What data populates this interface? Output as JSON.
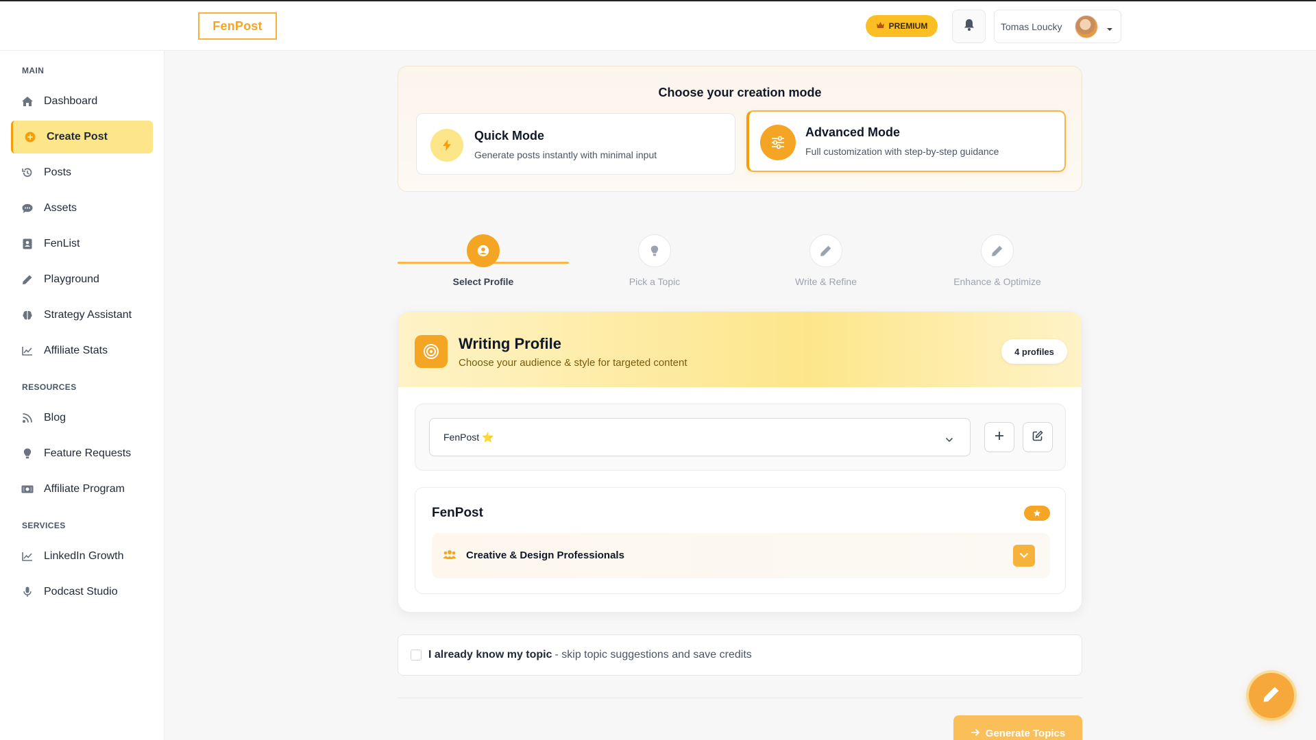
{
  "header": {
    "logo": "FenPost",
    "premium_label": "PREMIUM",
    "user_name": "Tomas Loucky"
  },
  "sidebar": {
    "sections": [
      {
        "title": "MAIN",
        "items": [
          {
            "label": "Dashboard",
            "icon": "home-icon"
          },
          {
            "label": "Create Post",
            "icon": "plus-circle-icon",
            "active": true
          },
          {
            "label": "Posts",
            "icon": "history-icon"
          },
          {
            "label": "Assets",
            "icon": "chat-icon"
          },
          {
            "label": "FenList",
            "icon": "contact-card-icon"
          },
          {
            "label": "Playground",
            "icon": "pencil-icon"
          },
          {
            "label": "Strategy Assistant",
            "icon": "brain-icon"
          },
          {
            "label": "Affiliate Stats",
            "icon": "line-chart-icon"
          }
        ]
      },
      {
        "title": "RESOURCES",
        "items": [
          {
            "label": "Blog",
            "icon": "rss-icon"
          },
          {
            "label": "Feature Requests",
            "icon": "lightbulb-icon"
          },
          {
            "label": "Affiliate Program",
            "icon": "money-icon"
          }
        ]
      },
      {
        "title": "SERVICES",
        "items": [
          {
            "label": "LinkedIn Growth",
            "icon": "line-chart-icon"
          },
          {
            "label": "Podcast Studio",
            "icon": "microphone-icon"
          }
        ]
      }
    ]
  },
  "mode": {
    "title": "Choose your creation mode",
    "quick": {
      "name": "Quick Mode",
      "desc": "Generate posts instantly with minimal input"
    },
    "advanced": {
      "name": "Advanced Mode",
      "desc": "Full customization with step-by-step guidance",
      "selected": true
    }
  },
  "steps": [
    {
      "label": "Select Profile",
      "icon": "user-circle-icon",
      "active": true
    },
    {
      "label": "Pick a Topic",
      "icon": "lightbulb-icon"
    },
    {
      "label": "Write & Refine",
      "icon": "pencil-icon"
    },
    {
      "label": "Enhance & Optimize",
      "icon": "pencil-icon"
    }
  ],
  "writing_profile": {
    "title": "Writing Profile",
    "subtitle": "Choose your audience & style for targeted content",
    "count": "4 profiles",
    "selected_profile": "FenPost ⭐",
    "detail_name": "FenPost",
    "audience": "Creative & Design Professionals"
  },
  "topic_checkbox": {
    "strong": "I already know my topic",
    "rest": "- skip topic suggestions and save credits",
    "checked": false
  },
  "generate_button": "Generate Topics",
  "colors": {
    "accent": "#f5a524",
    "accent_light": "#fde68a",
    "premium": "#fbbf24"
  }
}
